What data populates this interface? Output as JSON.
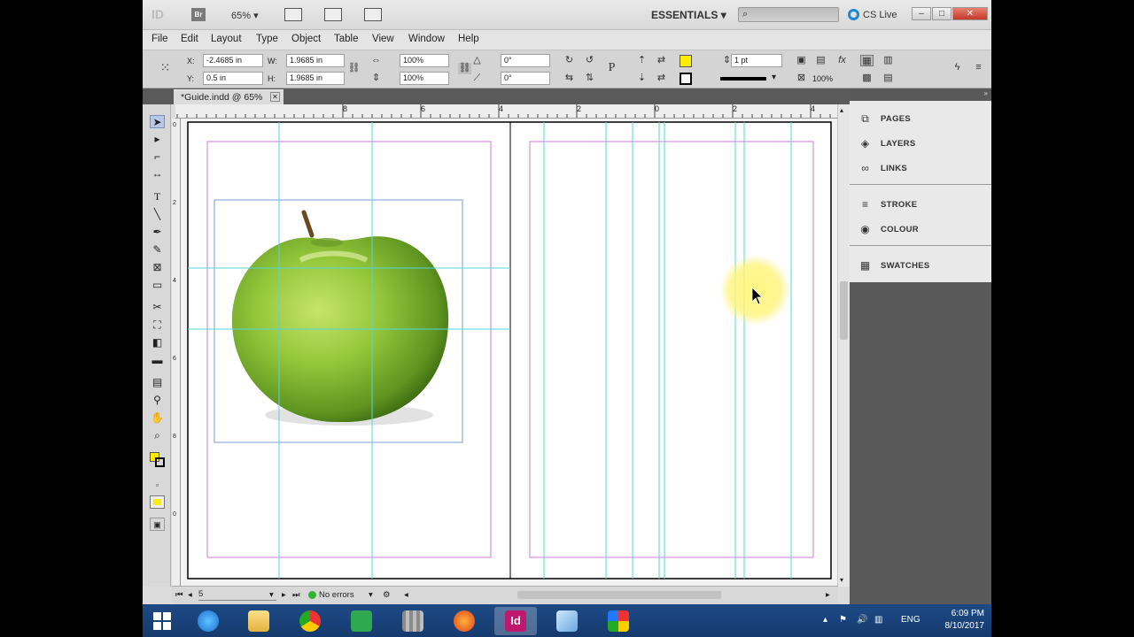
{
  "titlebar": {
    "app_logo": "ID",
    "bridge": "Br",
    "zoom": "65%",
    "workspace": "ESSENTIALS",
    "search_placeholder": "",
    "cs_live": "CS Live"
  },
  "menu": [
    "File",
    "Edit",
    "Layout",
    "Type",
    "Object",
    "Table",
    "View",
    "Window",
    "Help"
  ],
  "control": {
    "x_label": "X:",
    "x_value": "-2.4685 in",
    "y_label": "Y:",
    "y_value": "0.5 in",
    "w_label": "W:",
    "w_value": "1.9685 in",
    "h_label": "H:",
    "h_value": "1.9685 in",
    "scale_x": "100%",
    "scale_y": "100%",
    "rotate": "0°",
    "shear": "0°",
    "stroke_weight": "1 pt",
    "opacity": "100%",
    "fill_color": "#ffed00",
    "stroke_color": "#000000"
  },
  "document_tab": {
    "label": "*Guide.indd @ 65%"
  },
  "ruler_h": [
    "8",
    "6",
    "4",
    "2",
    "0",
    "2",
    "4",
    "6",
    "8"
  ],
  "ruler_v": [
    "0",
    "2",
    "4",
    "6",
    "8",
    "0"
  ],
  "status": {
    "page": "5",
    "preflight": "No errors"
  },
  "panels": [
    {
      "label": "PAGES",
      "icon": "pages-icon"
    },
    {
      "label": "LAYERS",
      "icon": "layers-icon"
    },
    {
      "label": "LINKS",
      "icon": "links-icon"
    },
    {
      "label": "STROKE",
      "icon": "stroke-icon"
    },
    {
      "label": "COLOUR",
      "icon": "colour-icon"
    },
    {
      "label": "SWATCHES",
      "icon": "swatches-icon"
    }
  ],
  "taskbar": {
    "language": "ENG",
    "time": "6:09 PM",
    "date": "8/10/2017"
  },
  "colors": {
    "margin_guide": "#d67ad8",
    "ruler_guide": "#53d6dc",
    "apple": "#8fc43c",
    "cursor_highlight": "#fff57a"
  }
}
